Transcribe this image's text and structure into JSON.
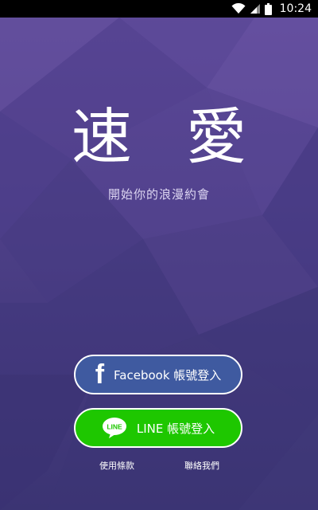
{
  "status_bar": {
    "time": "10:24",
    "icons": [
      "wifi-icon",
      "signal-icon",
      "battery-icon"
    ]
  },
  "app": {
    "title": "速 愛",
    "subtitle": "開始你的浪漫約會"
  },
  "login": {
    "facebook_label": "Facebook 帳號登入",
    "line_label": "LINE 帳號登入",
    "line_logo_text": "LINE"
  },
  "footer": {
    "terms": "使用條款",
    "contact": "聯絡我們"
  },
  "colors": {
    "background_top": "#5e4a9a",
    "background_bottom": "#3e3676",
    "facebook_blue": "#3f5aa0",
    "line_green": "#1ec700"
  }
}
